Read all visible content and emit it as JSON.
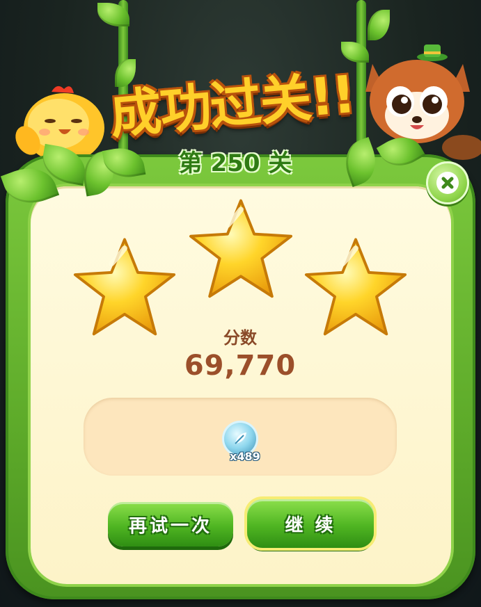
{
  "title": "成功过关!!",
  "level_label": "第 250 关",
  "stars_earned": 3,
  "stars_total": 3,
  "score": {
    "label": "分数",
    "value": "69,770"
  },
  "reward": {
    "icon": "leaf-coin-icon",
    "count": "x489"
  },
  "buttons": {
    "retry": "再试一次",
    "continue": "继 续"
  },
  "close_icon": "close-icon",
  "colors": {
    "panel_green": "#5eab2a",
    "panel_cream": "#fdf3c8",
    "star_gold": "#ffc21a",
    "title_gold": "#ffd02a",
    "score_brown": "#9b4f2a"
  }
}
